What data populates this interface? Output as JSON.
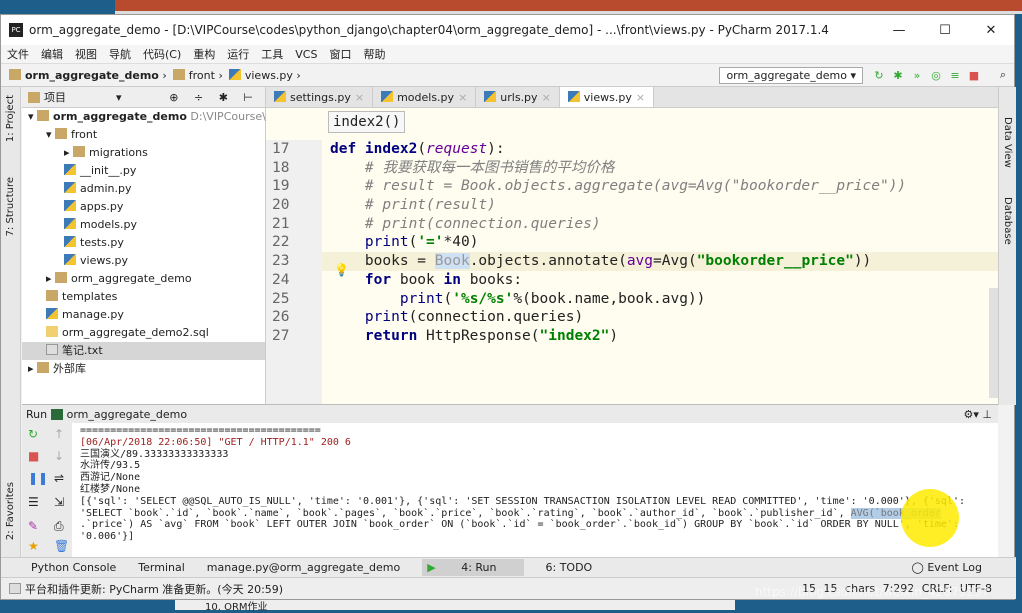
{
  "window": {
    "title": "orm_aggregate_demo - [D:\\VIPCourse\\codes\\python_django\\chapter04\\orm_aggregate_demo] - ...\\front\\views.py - PyCharm 2017.1.4",
    "controls": [
      "—",
      "☐",
      "✕"
    ]
  },
  "menu": [
    "文件",
    "编辑",
    "视图",
    "导航",
    "代码(C)",
    "重构",
    "运行",
    "工具",
    "VCS",
    "窗口",
    "帮助"
  ],
  "breadcrumb": [
    "orm_aggregate_demo",
    "front",
    "views.py"
  ],
  "run_config": "orm_aggregate_demo ▾",
  "toolbar_icons": [
    "rerun-icon",
    "debug-icon",
    "coverage-icon",
    "profile-icon",
    "concurrency-icon",
    "stop-icon",
    "search-icon"
  ],
  "left_strip": [
    "1: Project",
    "7: Structure",
    "2: Favorites"
  ],
  "right_strip": [
    "Data View",
    "Database"
  ],
  "project": {
    "header": "项目",
    "root": "orm_aggregate_demo",
    "root_path": "D:\\VIPCourse\\cod",
    "items": [
      {
        "label": "front",
        "type": "folder",
        "depth": 1
      },
      {
        "label": "migrations",
        "type": "folder",
        "depth": 2
      },
      {
        "label": "__init__.py",
        "type": "py",
        "depth": 2
      },
      {
        "label": "admin.py",
        "type": "py",
        "depth": 2
      },
      {
        "label": "apps.py",
        "type": "py",
        "depth": 2
      },
      {
        "label": "models.py",
        "type": "py",
        "depth": 2
      },
      {
        "label": "tests.py",
        "type": "py",
        "depth": 2
      },
      {
        "label": "views.py",
        "type": "py",
        "depth": 2
      },
      {
        "label": "orm_aggregate_demo",
        "type": "folder",
        "depth": 1
      },
      {
        "label": "templates",
        "type": "folder",
        "depth": 1
      },
      {
        "label": "manage.py",
        "type": "py",
        "depth": 1
      },
      {
        "label": "orm_aggregate_demo2.sql",
        "type": "sql",
        "depth": 1
      },
      {
        "label": "笔记.txt",
        "type": "txt",
        "depth": 1
      },
      {
        "label": "外部库",
        "type": "lib",
        "depth": 0
      }
    ]
  },
  "tabs": [
    {
      "label": "settings.py"
    },
    {
      "label": "models.py"
    },
    {
      "label": "urls.py"
    },
    {
      "label": "views.py",
      "active": true
    }
  ],
  "editor": {
    "tooltip": "index2()",
    "current_line": 23,
    "lines": [
      {
        "n": "17",
        "t": [
          [
            "def ",
            "kw"
          ],
          [
            "index2",
            "fnb"
          ],
          [
            "(",
            ""
          ],
          [
            "request",
            "pa"
          ],
          [
            "):",
            ""
          ]
        ]
      },
      {
        "n": "18",
        "t": [
          [
            "    # 我要获取每一本图书销售的平均价格",
            "cm"
          ]
        ]
      },
      {
        "n": "19",
        "t": [
          [
            "    # result = Book.objects.aggregate(avg=Avg(\"bookorder__price\"))",
            "cm"
          ]
        ]
      },
      {
        "n": "20",
        "t": [
          [
            "    # print(result)",
            "cm"
          ]
        ]
      },
      {
        "n": "21",
        "t": [
          [
            "    # print(connection.queries)",
            "cm"
          ]
        ]
      },
      {
        "n": "22",
        "t": [
          [
            "    ",
            ""
          ],
          [
            "print",
            "fn"
          ],
          [
            "(",
            ""
          ],
          [
            "'='",
            "st"
          ],
          [
            "*40)",
            ""
          ]
        ]
      },
      {
        "n": "23",
        "t": [
          [
            "    books = ",
            ""
          ],
          [
            "Book",
            "hl"
          ],
          [
            ".objects.annotate(",
            ""
          ],
          [
            "avg",
            "kwarg"
          ],
          [
            "=Avg(",
            ""
          ],
          [
            "\"bookorder__price\"",
            "st"
          ],
          [
            "))",
            ""
          ]
        ]
      },
      {
        "n": "24",
        "t": [
          [
            "    ",
            ""
          ],
          [
            "for ",
            "kw"
          ],
          [
            "book ",
            ""
          ],
          [
            "in ",
            "kw"
          ],
          [
            "books:",
            ""
          ]
        ]
      },
      {
        "n": "25",
        "t": [
          [
            "        ",
            ""
          ],
          [
            "print",
            "fn"
          ],
          [
            "(",
            ""
          ],
          [
            "'%s/%s'",
            "st"
          ],
          [
            "%(book.name,book.avg))",
            ""
          ]
        ]
      },
      {
        "n": "26",
        "t": [
          [
            "    ",
            ""
          ],
          [
            "print",
            "fn"
          ],
          [
            "(connection.queries)",
            ""
          ]
        ]
      },
      {
        "n": "27",
        "t": [
          [
            "    ",
            ""
          ],
          [
            "return ",
            "kw"
          ],
          [
            "HttpResponse(",
            ""
          ],
          [
            "\"index2\"",
            "st"
          ],
          [
            ")",
            ""
          ]
        ]
      }
    ]
  },
  "run": {
    "label": "Run",
    "config": "orm_aggregate_demo",
    "console": [
      {
        "text": "========================================",
        "cls": ""
      },
      {
        "text": "[06/Apr/2018 22:06:50] \"GET / HTTP/1.1\" 200 6",
        "cls": "red"
      },
      {
        "text": "三国演义/89.33333333333333",
        "cls": ""
      },
      {
        "text": "水浒传/93.5",
        "cls": ""
      },
      {
        "text": "西游记/None",
        "cls": ""
      },
      {
        "text": "红楼梦/None",
        "cls": ""
      },
      {
        "text": "[{'sql': 'SELECT @@SQL_AUTO_IS_NULL', 'time': '0.001'}, {'sql': 'SET SESSION TRANSACTION ISOLATION LEVEL READ COMMITTED', 'time': '0.000'}, {'sql':",
        "cls": ""
      },
      {
        "text": "'SELECT `book`.`id`, `book`.`name`, `book`.`pages`, `book`.`price`, `book`.`rating`, `book`.`author_id`, `book`.`publisher_id`, ",
        "cls": "",
        "sel": "AVG(`book_order"
      },
      {
        "text": ".`price`) AS `avg` FROM `book` LEFT OUTER JOIN `book_order` ON (`book`.`id` = `book_order`.`book_id`) GROUP BY `book`.`id` ORDER BY NULL', 'time':",
        "cls": ""
      },
      {
        "text": "'0.006'}]",
        "cls": ""
      }
    ]
  },
  "bottom_tabs": [
    "Python Console",
    "Terminal",
    "manage.py@orm_aggregate_demo",
    "4: Run",
    "6: TODO"
  ],
  "event_log": "Event Log",
  "status": {
    "message": "平台和插件更新: PyCharm 准备更新。(今天 20:59)",
    "chars": "15 15 chars",
    "position": "7:292",
    "line_sep": "CRLF:",
    "encoding": "UTF-8"
  },
  "watermark": "https://blog.csdn.net/weixin_42879237",
  "background_item": "10. ORM作业"
}
